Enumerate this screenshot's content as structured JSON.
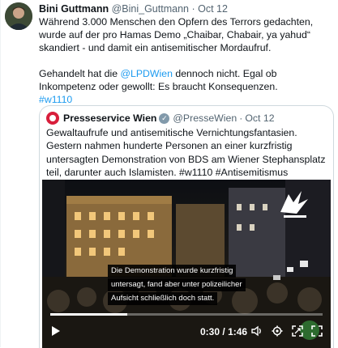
{
  "author": {
    "name": "Bini Guttmann",
    "handle": "@Bini_Guttmann",
    "separator": "·",
    "date": "Oct 12"
  },
  "tweet": {
    "line1": "Während 3.000 Menschen den Opfern des Terrors gedachten, wurde auf der pro Hamas Demo „Chaibar, Chabair, ya yahud“ skandiert - und damit ein antisemitischer Mordaufruf.",
    "line2_pre": "Gehandelt hat die ",
    "mention": "@LPDWien",
    "line2_post": " dennoch nicht. Egal ob Inkompetenz oder gewollt: Es braucht Konsequenzen.",
    "hashtag": "#w1110"
  },
  "quote": {
    "name": "Presseservice Wien",
    "verified_icon": "✓",
    "handle": "@PresseWien",
    "separator": "·",
    "date": "Oct 12",
    "text": "Gewaltaufrufe und antisemitische Vernichtungsfantasien. Gestern nahmen hunderte Personen an einer kurzfristig untersagten Demonstration von BDS am Wiener Stephansplatz teil, darunter auch Islamisten. #w1110 #Antisemitismus"
  },
  "video": {
    "caption_lines": [
      "Die Demonstration wurde  kurzfristig",
      "untersagt, fand aber unter polizeilicher",
      "Aufsicht schließlich doch statt."
    ],
    "elapsed": "0:30",
    "separator": "/",
    "duration": "1:46",
    "progress_fraction": 0.283,
    "colors": {
      "accent": "#1d9bf0",
      "logo": "#ffffff"
    }
  },
  "icons": {
    "play": "play-icon",
    "volume": "volume-icon",
    "settings": "settings-icon",
    "fullscreen": "fullscreen-icon",
    "expand": "expand-icon"
  }
}
